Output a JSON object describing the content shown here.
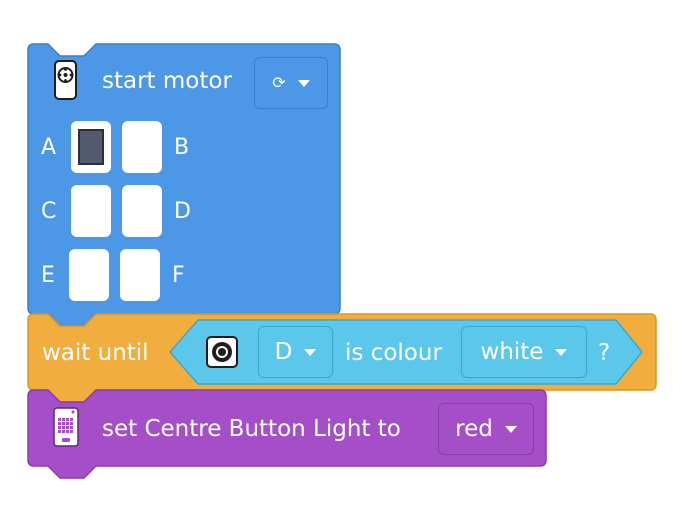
{
  "blocks": {
    "motor": {
      "label": "start motor",
      "direction_icon": "rotate-icon",
      "ports": [
        {
          "letter": "A",
          "selected": true
        },
        {
          "letter": "B",
          "selected": false
        },
        {
          "letter": "C",
          "selected": false
        },
        {
          "letter": "D",
          "selected": false
        },
        {
          "letter": "E",
          "selected": false
        },
        {
          "letter": "F",
          "selected": false
        }
      ],
      "color": "#4c97e6"
    },
    "wait": {
      "prefix": "wait until",
      "sensor_port": "D",
      "middle": "is colour",
      "colour_value": "white",
      "suffix": "?",
      "color": "#f2ad3f",
      "sensor_color": "#5bc7ea"
    },
    "light": {
      "label": "set Centre Button Light to",
      "value": "red",
      "color": "#a44fc8"
    }
  }
}
